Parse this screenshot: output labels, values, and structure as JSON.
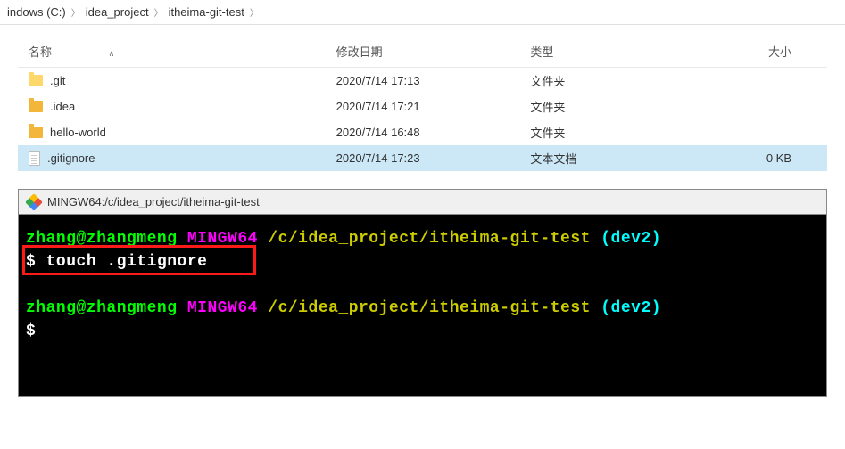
{
  "breadcrumb": {
    "items": [
      "indows (C:)",
      "idea_project",
      "itheima-git-test"
    ]
  },
  "headers": {
    "name": "名称",
    "date": "修改日期",
    "type": "类型",
    "size": "大小"
  },
  "files": [
    {
      "name": ".git",
      "date": "2020/7/14 17:13",
      "type": "文件夹",
      "size": "",
      "kind": "folder",
      "selected": false
    },
    {
      "name": ".idea",
      "date": "2020/7/14 17:21",
      "type": "文件夹",
      "size": "",
      "kind": "folder-dark",
      "selected": false
    },
    {
      "name": "hello-world",
      "date": "2020/7/14 16:48",
      "type": "文件夹",
      "size": "",
      "kind": "folder-dark",
      "selected": false
    },
    {
      "name": ".gitignore",
      "date": "2020/7/14 17:23",
      "type": "文本文档",
      "size": "0 KB",
      "kind": "file",
      "selected": true
    }
  ],
  "terminal": {
    "title": "MINGW64:/c/idea_project/itheima-git-test",
    "prompt": {
      "user": "zhang@zhangmeng",
      "env": "MINGW64",
      "path": "/c/idea_project/itheima-git-test",
      "branch": "(dev2)"
    },
    "command": "touch .gitignore",
    "dollar": "$"
  }
}
